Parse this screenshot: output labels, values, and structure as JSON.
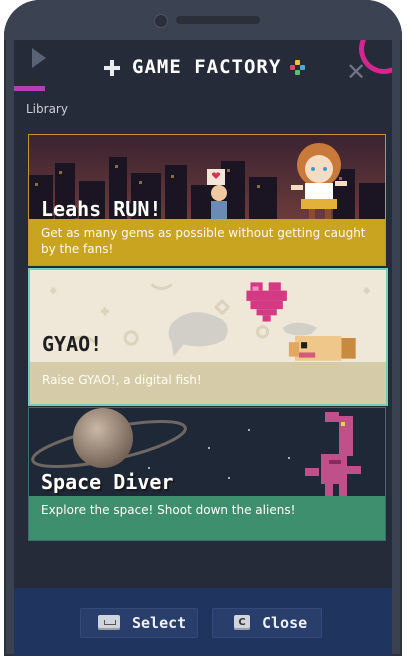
{
  "app": {
    "title": "GAME FACTORY"
  },
  "library": {
    "label": "Library"
  },
  "games": [
    {
      "title": "Leahs RUN!",
      "description": "Get as many gems as possible without getting caught by the fans!"
    },
    {
      "title": "GYAO!",
      "description": "Raise GYAO!, a digital fish!"
    },
    {
      "title": "Space Diver",
      "description": "Explore the space! Shoot down the aliens!"
    }
  ],
  "footer": {
    "select_label": "Select",
    "close_label": "Close",
    "close_key": "C"
  },
  "icons": {
    "header_plus": "plus-icon",
    "header_dots": "colored-dots-icon",
    "select_key": "space-key-icon",
    "close_key": "c-key-icon"
  },
  "colors": {
    "background": "#262b39",
    "card1_desc": "#c9a421",
    "card2_desc": "#d6cba9",
    "card3_desc": "#3e8f6d",
    "selected_border": "#6ecfbf",
    "footer": "#1f3560"
  }
}
